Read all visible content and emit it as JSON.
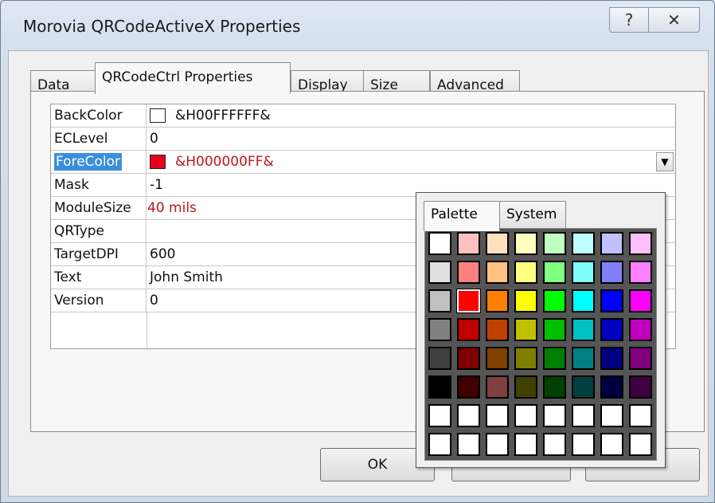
{
  "window": {
    "title": "Morovia QRCodeActiveX Properties",
    "help_icon": "?",
    "close_icon": "✕"
  },
  "tabs": [
    {
      "label": "Data"
    },
    {
      "label": "QRCodeCtrl Properties"
    },
    {
      "label": "Display"
    },
    {
      "label": "Size"
    },
    {
      "label": "Advanced"
    }
  ],
  "properties": [
    {
      "name": "BackColor",
      "value": "&H00FFFFFF&",
      "swatch": "#ffffff"
    },
    {
      "name": "ECLevel",
      "value": "0"
    },
    {
      "name": "ForeColor",
      "value": "&H000000FF&",
      "swatch": "#e8001e"
    },
    {
      "name": "Mask",
      "value": "-1"
    },
    {
      "name": "ModuleSize",
      "value": "40 mils"
    },
    {
      "name": "QRType",
      "value": ""
    },
    {
      "name": "TargetDPI",
      "value": "600"
    },
    {
      "name": "Text",
      "value": "John Smith"
    },
    {
      "name": "Version",
      "value": "0"
    }
  ],
  "dropdown_icon": "▼",
  "buttons": {
    "ok": "OK"
  },
  "color_popup": {
    "tabs": [
      {
        "label": "Palette"
      },
      {
        "label": "System"
      }
    ],
    "palette": [
      [
        "#ffffff",
        "#ffc0c0",
        "#ffe0c0",
        "#ffffc0",
        "#c0ffc0",
        "#c0ffff",
        "#c0c0ff",
        "#ffc0ff"
      ],
      [
        "#e0e0e0",
        "#ff8080",
        "#ffc080",
        "#ffff80",
        "#80ff80",
        "#80ffff",
        "#8080ff",
        "#ff80ff"
      ],
      [
        "#c0c0c0",
        "#ff0000",
        "#ff8000",
        "#ffff00",
        "#00ff00",
        "#00ffff",
        "#0000ff",
        "#ff00ff"
      ],
      [
        "#808080",
        "#c00000",
        "#c04000",
        "#c0c000",
        "#00c000",
        "#00c0c0",
        "#0000c0",
        "#c000c0"
      ],
      [
        "#404040",
        "#800000",
        "#804000",
        "#808000",
        "#008000",
        "#008080",
        "#000080",
        "#800080"
      ],
      [
        "#000000",
        "#400000",
        "#804040",
        "#404000",
        "#004000",
        "#004040",
        "#000040",
        "#400040"
      ],
      [
        "#ffffff",
        "#ffffff",
        "#ffffff",
        "#ffffff",
        "#ffffff",
        "#ffffff",
        "#ffffff",
        "#ffffff"
      ],
      [
        "#ffffff",
        "#ffffff",
        "#ffffff",
        "#ffffff",
        "#ffffff",
        "#ffffff",
        "#ffffff",
        "#ffffff"
      ]
    ]
  }
}
